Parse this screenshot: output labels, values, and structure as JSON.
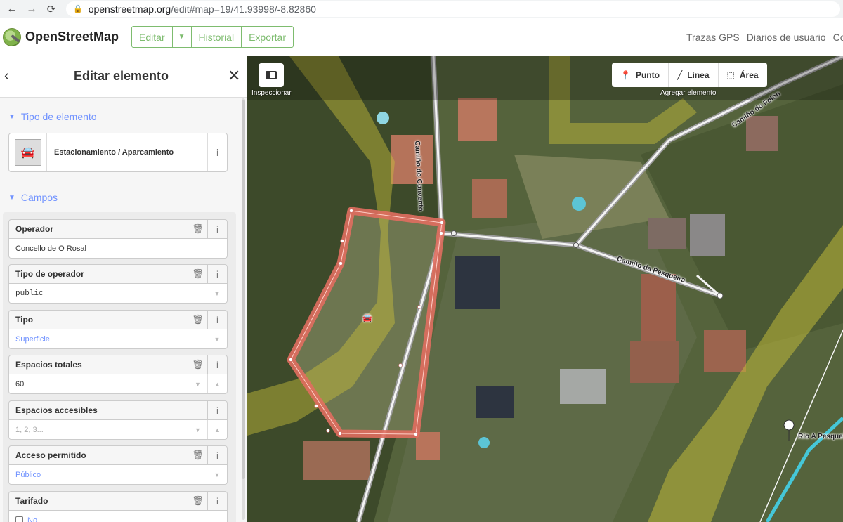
{
  "browser": {
    "back_icon": "arrow-left-icon",
    "forward_icon": "arrow-right-icon",
    "reload_icon": "reload-icon",
    "url_host": "openstreetmap.org",
    "url_path": "/edit#map=19/41.93998/-8.82860"
  },
  "header": {
    "brand": "OpenStreetMap",
    "edit_label": "Editar",
    "history_label": "Historial",
    "export_label": "Exportar",
    "links": [
      "Trazas GPS",
      "Diarios de usuario",
      "Co"
    ],
    "accent_color": "#7ebc6f"
  },
  "sidebar": {
    "title": "Editar elemento",
    "section_type": "Tipo de elemento",
    "preset_name": "Estacionamiento / Aparcamiento",
    "preset_icon": "car-parking-icon",
    "section_fields": "Campos",
    "fields": [
      {
        "label": "Operador",
        "value": "Concello de O Rosal"
      },
      {
        "label": "Tipo de operador",
        "value": "public"
      },
      {
        "label": "Tipo",
        "value": "Superficie"
      },
      {
        "label": "Espacios totales",
        "value": "60"
      },
      {
        "label": "Espacios accesibles",
        "placeholder": "1, 2, 3..."
      },
      {
        "label": "Acceso permitido",
        "value": "Público"
      },
      {
        "label": "Tarifado",
        "value": "No"
      }
    ]
  },
  "map": {
    "inspect_label": "Inspeccionar",
    "add_point": "Punto",
    "add_line": "Línea",
    "add_area": "Área",
    "add_feature_label": "Agregar elemento",
    "roads": [
      "Camiño do Convento",
      "Camiño do Folón",
      "Camiño da Pesqueira"
    ],
    "river_label": "Río A Pesqueira",
    "area_color": "#e06e5f"
  }
}
